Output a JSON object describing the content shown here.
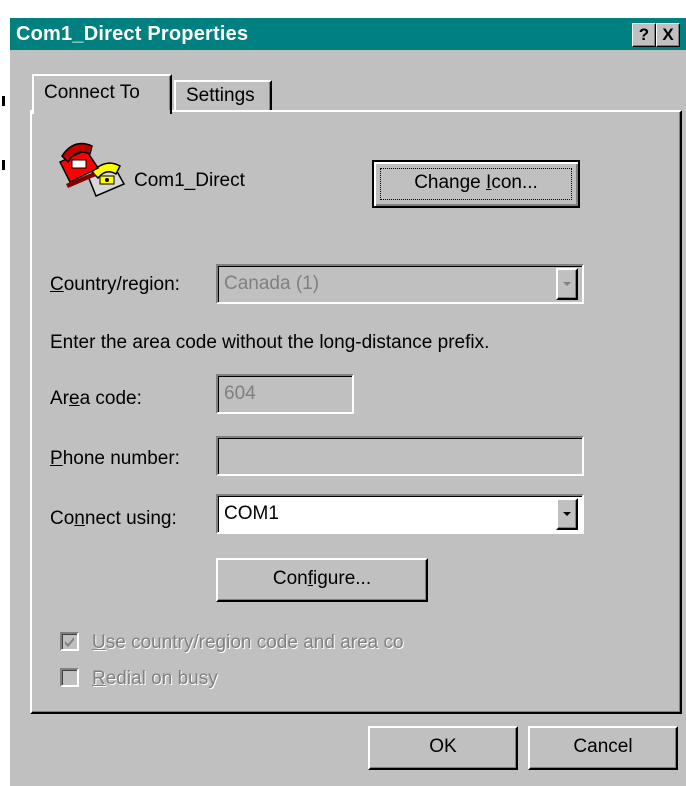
{
  "window": {
    "title": "Com1_Direct Properties",
    "help_glyph": "?",
    "close_glyph": "X"
  },
  "tabs": [
    {
      "label": "Connect To",
      "active": true
    },
    {
      "label": "Settings",
      "active": false
    }
  ],
  "connection": {
    "name": "Com1_Direct",
    "icon": "phone-connection-icon",
    "change_icon_label_pre": "Change ",
    "change_icon_label_mn": "I",
    "change_icon_label_post": "con..."
  },
  "country": {
    "label_mn": "C",
    "label_rest": "ountry/region:",
    "value": "Canada (1)"
  },
  "instruction": "Enter the area code without the long-distance prefix.",
  "area_code": {
    "label_pre": "Ar",
    "label_mn": "e",
    "label_post": "a code:",
    "value": "604"
  },
  "phone_number": {
    "label_mn": "P",
    "label_rest": "hone number:",
    "value": ""
  },
  "connect_using": {
    "label_pre": "Co",
    "label_mn": "n",
    "label_post": "nect using:",
    "value": "COM1"
  },
  "configure": {
    "label_pre": "Con",
    "label_mn": "f",
    "label_post": "igure..."
  },
  "options": [
    {
      "label_mn": "U",
      "label_rest": "se country/region code and area co",
      "checked": true,
      "enabled": false
    },
    {
      "label_mn": "R",
      "label_rest": "edial on busy",
      "checked": false,
      "enabled": false
    }
  ],
  "buttons": {
    "ok": "OK",
    "cancel": "Cancel"
  },
  "colors": {
    "titlebar": "#008080",
    "face": "#c0c0c0",
    "disabled_text": "#808080"
  }
}
